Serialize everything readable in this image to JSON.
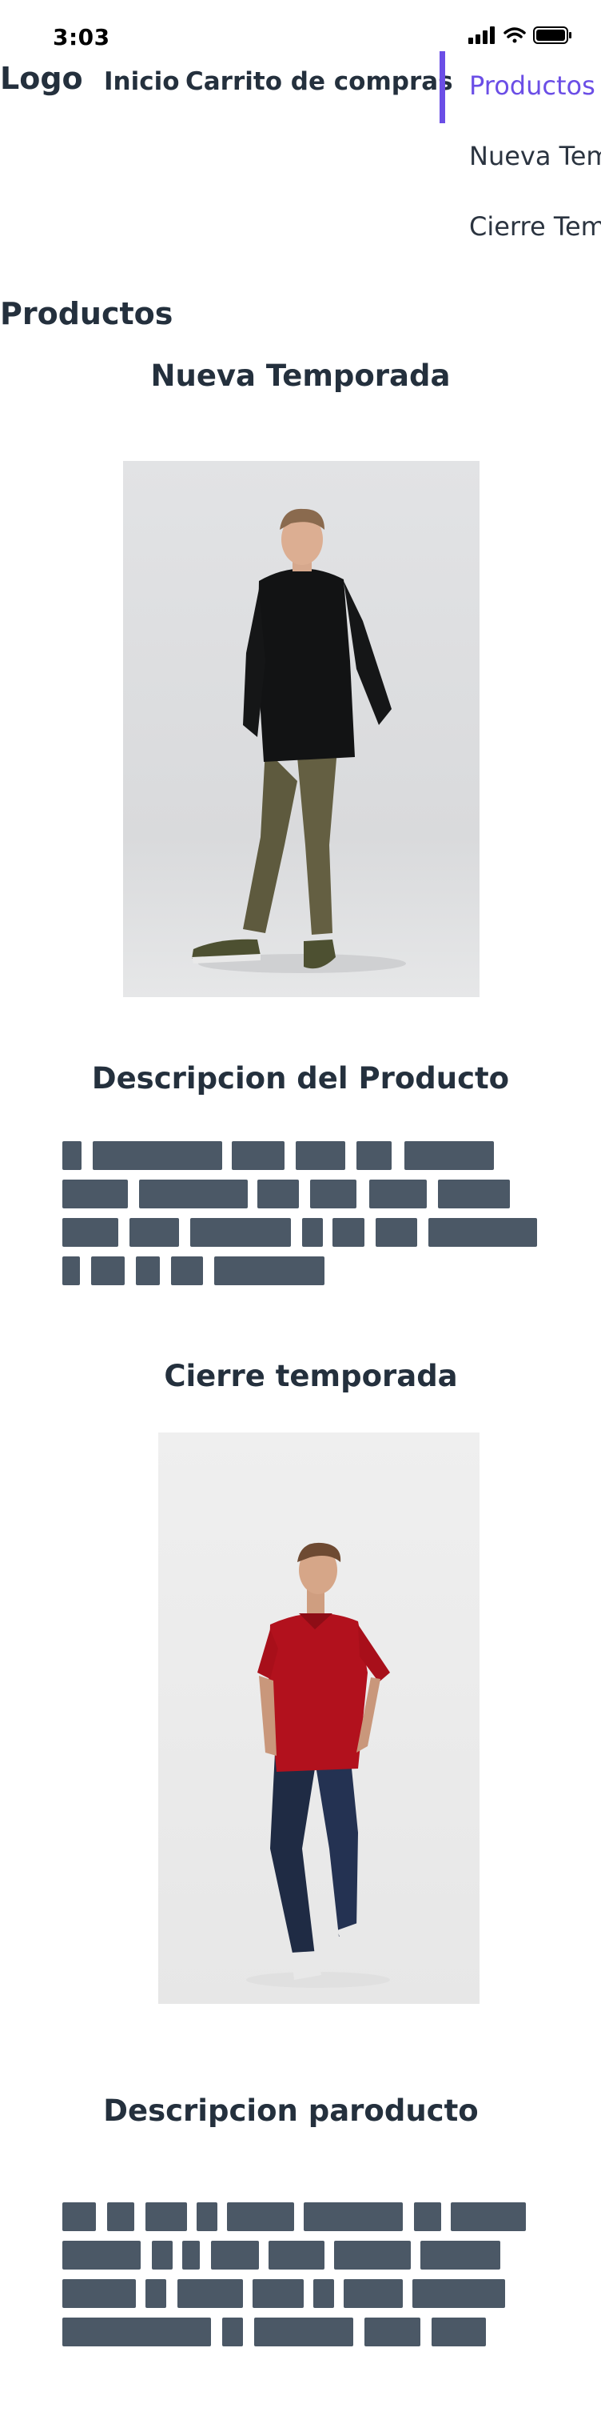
{
  "status_bar": {
    "time": "3:03"
  },
  "nav": {
    "logo": "Logo",
    "links": [
      "Inicio",
      "Carrito de compras"
    ]
  },
  "side_menu": {
    "items": [
      "Productos",
      "Nueva Temporada",
      "Cierre Temporada"
    ],
    "active_index": 0,
    "accent_color": "#6b4ee6"
  },
  "page": {
    "heading": "Productos"
  },
  "product_1": {
    "title": "Nueva Temporada",
    "image_icon": "model-black-sweater-olive-pants-photo",
    "description_title": "Descripcion del Producto"
  },
  "product_2": {
    "title": "Cierre temporada",
    "image_icon": "model-red-polo-jeans-photo",
    "description_title": "Descripcion paroducto"
  },
  "colors": {
    "text": "#24303d",
    "placeholder_bar": "#4b5866"
  }
}
